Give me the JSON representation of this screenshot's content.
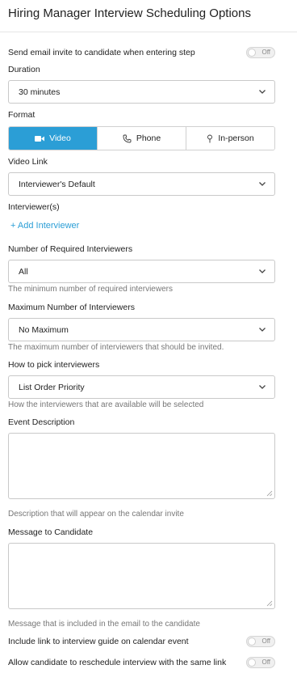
{
  "header": {
    "title": "Hiring Manager Interview Scheduling Options"
  },
  "send_email": {
    "label": "Send email invite to candidate when entering step",
    "toggle_state": "Off"
  },
  "duration": {
    "label": "Duration",
    "value": "30 minutes"
  },
  "format": {
    "label": "Format",
    "options": [
      {
        "label": "Video",
        "icon": "video-camera-icon",
        "active": true
      },
      {
        "label": "Phone",
        "icon": "phone-icon",
        "active": false
      },
      {
        "label": "In-person",
        "icon": "map-pin-icon",
        "active": false
      }
    ],
    "accent_color": "#2b9ed6"
  },
  "video_link": {
    "label": "Video Link",
    "value": "Interviewer's Default"
  },
  "interviewers": {
    "label": "Interviewer(s)",
    "add_label": "Add Interviewer"
  },
  "required_interviewers": {
    "label": "Number of Required Interviewers",
    "value": "All",
    "hint": "The minimum number of required interviewers"
  },
  "max_interviewers": {
    "label": "Maximum Number of Interviewers",
    "value": "No Maximum",
    "hint": "The maximum number of interviewers that should be invited."
  },
  "pick_interviewers": {
    "label": "How to pick interviewers",
    "value": "List Order Priority",
    "hint": "How the interviewers that are available will be selected"
  },
  "event_description": {
    "label": "Event Description",
    "value": "",
    "hint": "Description that will appear on the calendar invite"
  },
  "message_to_candidate": {
    "label": "Message to Candidate",
    "value": "",
    "hint": "Message that is included in the email to the candidate"
  },
  "include_guide": {
    "label": "Include link to interview guide on calendar event",
    "toggle_state": "Off"
  },
  "allow_reschedule": {
    "label": "Allow candidate to reschedule interview with the same link",
    "toggle_state": "Off"
  }
}
